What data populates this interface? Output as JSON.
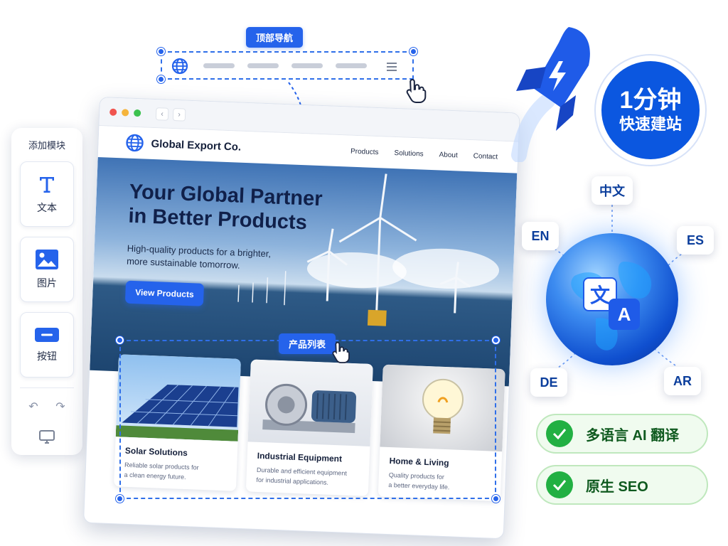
{
  "panel": {
    "title": "添加模块",
    "modules": [
      {
        "label": "文本",
        "icon": "text-icon"
      },
      {
        "label": "图片",
        "icon": "image-icon"
      },
      {
        "label": "按钮",
        "icon": "button-icon"
      }
    ],
    "undo_icon": "undo-icon",
    "redo_icon": "redo-icon",
    "preview_icon": "monitor-icon"
  },
  "nav_editor": {
    "tag": "顶部导航",
    "icons": [
      "globe-icon",
      "hamburger-menu-icon"
    ]
  },
  "site": {
    "brand": "Global Export Co.",
    "nav": [
      "Products",
      "Solutions",
      "About",
      "Contact"
    ],
    "hero": {
      "title_line1": "Your Global Partner",
      "title_line2": "in Better Products",
      "subtitle_line1": "High-quality products for a brighter,",
      "subtitle_line2": "more sustainable tomorrow.",
      "cta": "View Products"
    },
    "products_tag": "产品列表",
    "products": [
      {
        "title": "Solar Solutions",
        "desc_line1": "Reliable solar products for",
        "desc_line2": "a clean energy future."
      },
      {
        "title": "Industrial Equipment",
        "desc_line1": "Durable and efficient equipment",
        "desc_line2": "for industrial applications."
      },
      {
        "title": "Home & Living",
        "desc_line1": "Quality products for",
        "desc_line2": "a better everyday life."
      }
    ]
  },
  "badge": {
    "line1": "1分钟",
    "line2": "快速建站"
  },
  "languages": {
    "zh": "中文",
    "en": "EN",
    "es": "ES",
    "de": "DE",
    "ar": "AR",
    "globe_glyph_a": "文",
    "globe_glyph_b": "A"
  },
  "features": [
    {
      "label": "多语言 AI 翻译"
    },
    {
      "label": "原生 SEO"
    }
  ],
  "colors": {
    "accent": "#2563eb",
    "success": "#22b043"
  }
}
